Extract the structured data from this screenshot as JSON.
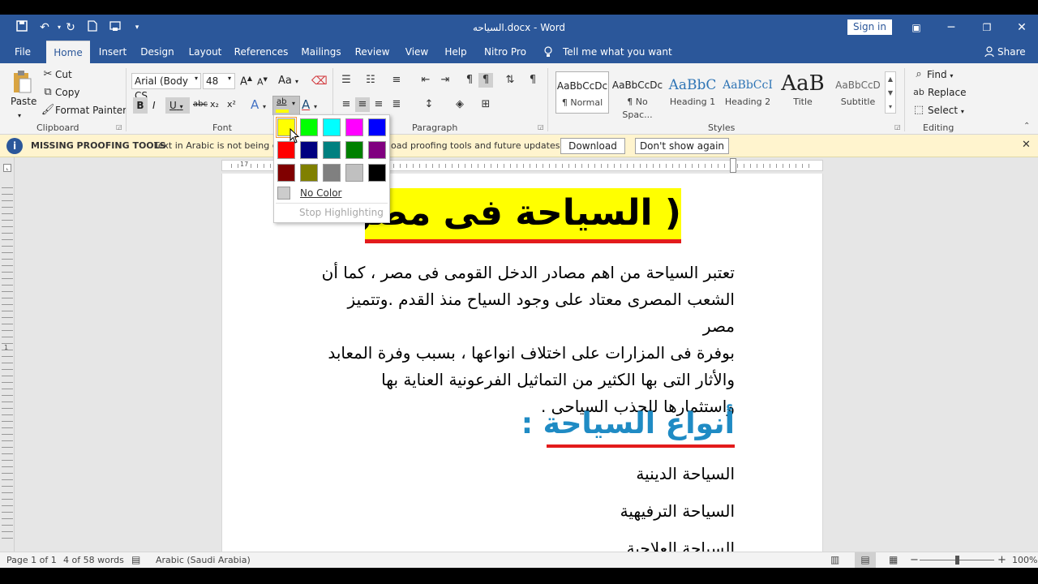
{
  "title_bar": {
    "title": "السياحه.docx  -  Word",
    "sign_in": "Sign in"
  },
  "icons": {
    "save": "save-icon",
    "undo": "undo-icon",
    "redo": "redo-icon",
    "new": "new-doc-icon",
    "print": "print-preview-icon",
    "customize": "chevron-down-icon",
    "ribbon_display": "ribbon-display-icon",
    "minimize": "minimize-icon",
    "restore": "restore-icon",
    "close": "close-icon",
    "lightbulb": "lightbulb-icon",
    "person": "person-icon"
  },
  "tabs": [
    "File",
    "Home",
    "Insert",
    "Design",
    "Layout",
    "References",
    "Mailings",
    "Review",
    "View",
    "Help",
    "Nitro Pro"
  ],
  "tell_me": "Tell me what you want to do",
  "share": "Share",
  "clipboard": {
    "paste": "Paste",
    "cut": "Cut",
    "copy": "Copy",
    "format_painter": "Format Painter",
    "group": "Clipboard"
  },
  "font": {
    "name": "Arial (Body CS",
    "size": "48",
    "group": "Font",
    "aa": "Aa",
    "bold": "B",
    "italic": "I",
    "underline": "U",
    "strike": "abc",
    "sub": "x₂",
    "sup": "x²",
    "grow": "A",
    "shrink": "A",
    "highlight_letters": "ab",
    "color_letter": "A"
  },
  "paragraph": {
    "group": "Paragraph"
  },
  "styles": {
    "group": "Styles",
    "items": [
      {
        "preview": "AaBbCcDc",
        "name": "¶ Normal"
      },
      {
        "preview": "AaBbCcDc",
        "name": "¶ No Spac..."
      },
      {
        "preview": "AaBbC",
        "name": "Heading 1"
      },
      {
        "preview": "AaBbCcI",
        "name": "Heading 2"
      },
      {
        "preview": "AaB",
        "name": "Title"
      },
      {
        "preview": "AaBbCcD",
        "name": "Subtitle"
      }
    ]
  },
  "editing": {
    "find": "Find",
    "replace": "Replace",
    "select": "Select",
    "group": "Editing"
  },
  "message_bar": {
    "label": "MISSING PROOFING TOOLS",
    "text": "Text in Arabic is not being che",
    "text2": "oad proofing tools and future updates?",
    "download": "Download",
    "dont_show": "Don't show again",
    "info_letter": "i"
  },
  "highlight_popup": {
    "colors": [
      "#ffff00",
      "#00ff00",
      "#00ffff",
      "#ff00ff",
      "#0000ff",
      "#ff0000",
      "#000080",
      "#008080",
      "#008000",
      "#800080",
      "#800000",
      "#808000",
      "#808080",
      "#c0c0c0",
      "#000000"
    ],
    "no_color": "No Color",
    "stop": "Stop Highlighting"
  },
  "ruler": {
    "h_left": "17",
    "v_left": "1"
  },
  "document": {
    "heading1": "( السياحة فى مصر)",
    "paragraph": [
      "تعتبر السياحة من اهم مصادر الدخل القومى فى مصر ، كما أن",
      "الشعب المصرى معتاد على وجود السياح منذ القدم .وتتميز مصر",
      "بوفرة فى المزارات على اختلاف انواعها ، بسبب وفرة المعابد",
      "والأثار التى بها الكثير من التماثيل الفرعونية العناية بها",
      "واستثمارها للجذب السياحى ."
    ],
    "heading2": "أنواع السياحة :",
    "list": [
      "السياحة الدينية",
      "السياحة الترفيهية",
      "السياحة العلاجية"
    ]
  },
  "status_bar": {
    "page": "Page 1 of 1",
    "words": "4 of 58 words",
    "language": "Arabic (Saudi Arabia)",
    "zoom": "100%",
    "minus": "−",
    "plus": "+"
  }
}
